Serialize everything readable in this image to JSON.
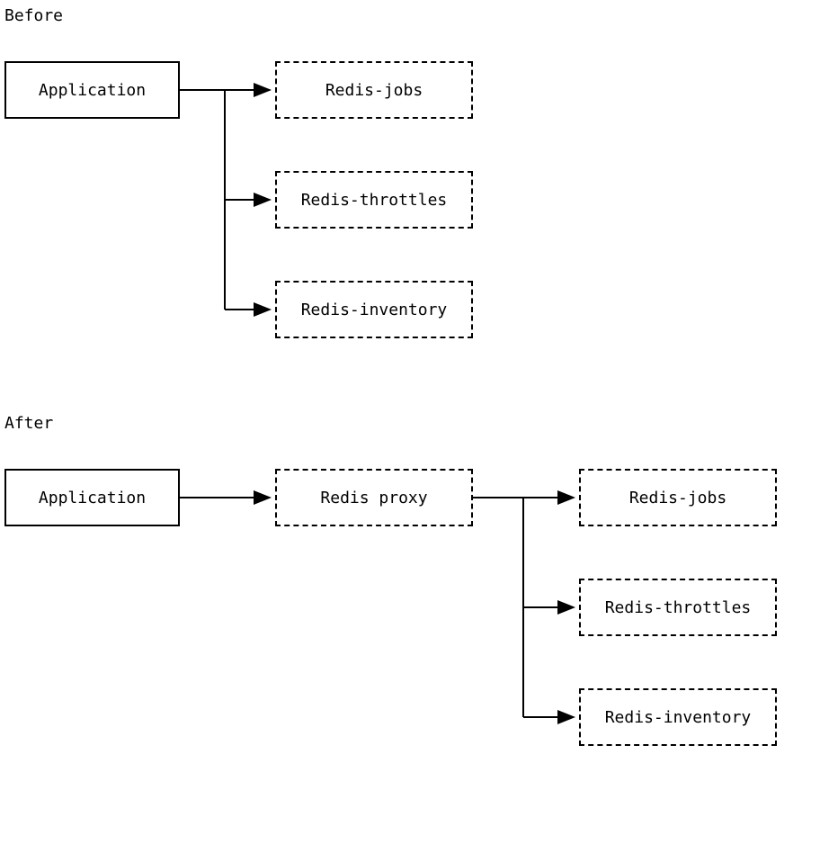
{
  "sections": {
    "before": {
      "label": "Before",
      "nodes": {
        "application": "Application",
        "redis_jobs": "Redis-jobs",
        "redis_throttles": "Redis-throttles",
        "redis_inventory": "Redis-inventory"
      }
    },
    "after": {
      "label": "After",
      "nodes": {
        "application": "Application",
        "redis_proxy": "Redis proxy",
        "redis_jobs": "Redis-jobs",
        "redis_throttles": "Redis-throttles",
        "redis_inventory": "Redis-inventory"
      }
    }
  }
}
